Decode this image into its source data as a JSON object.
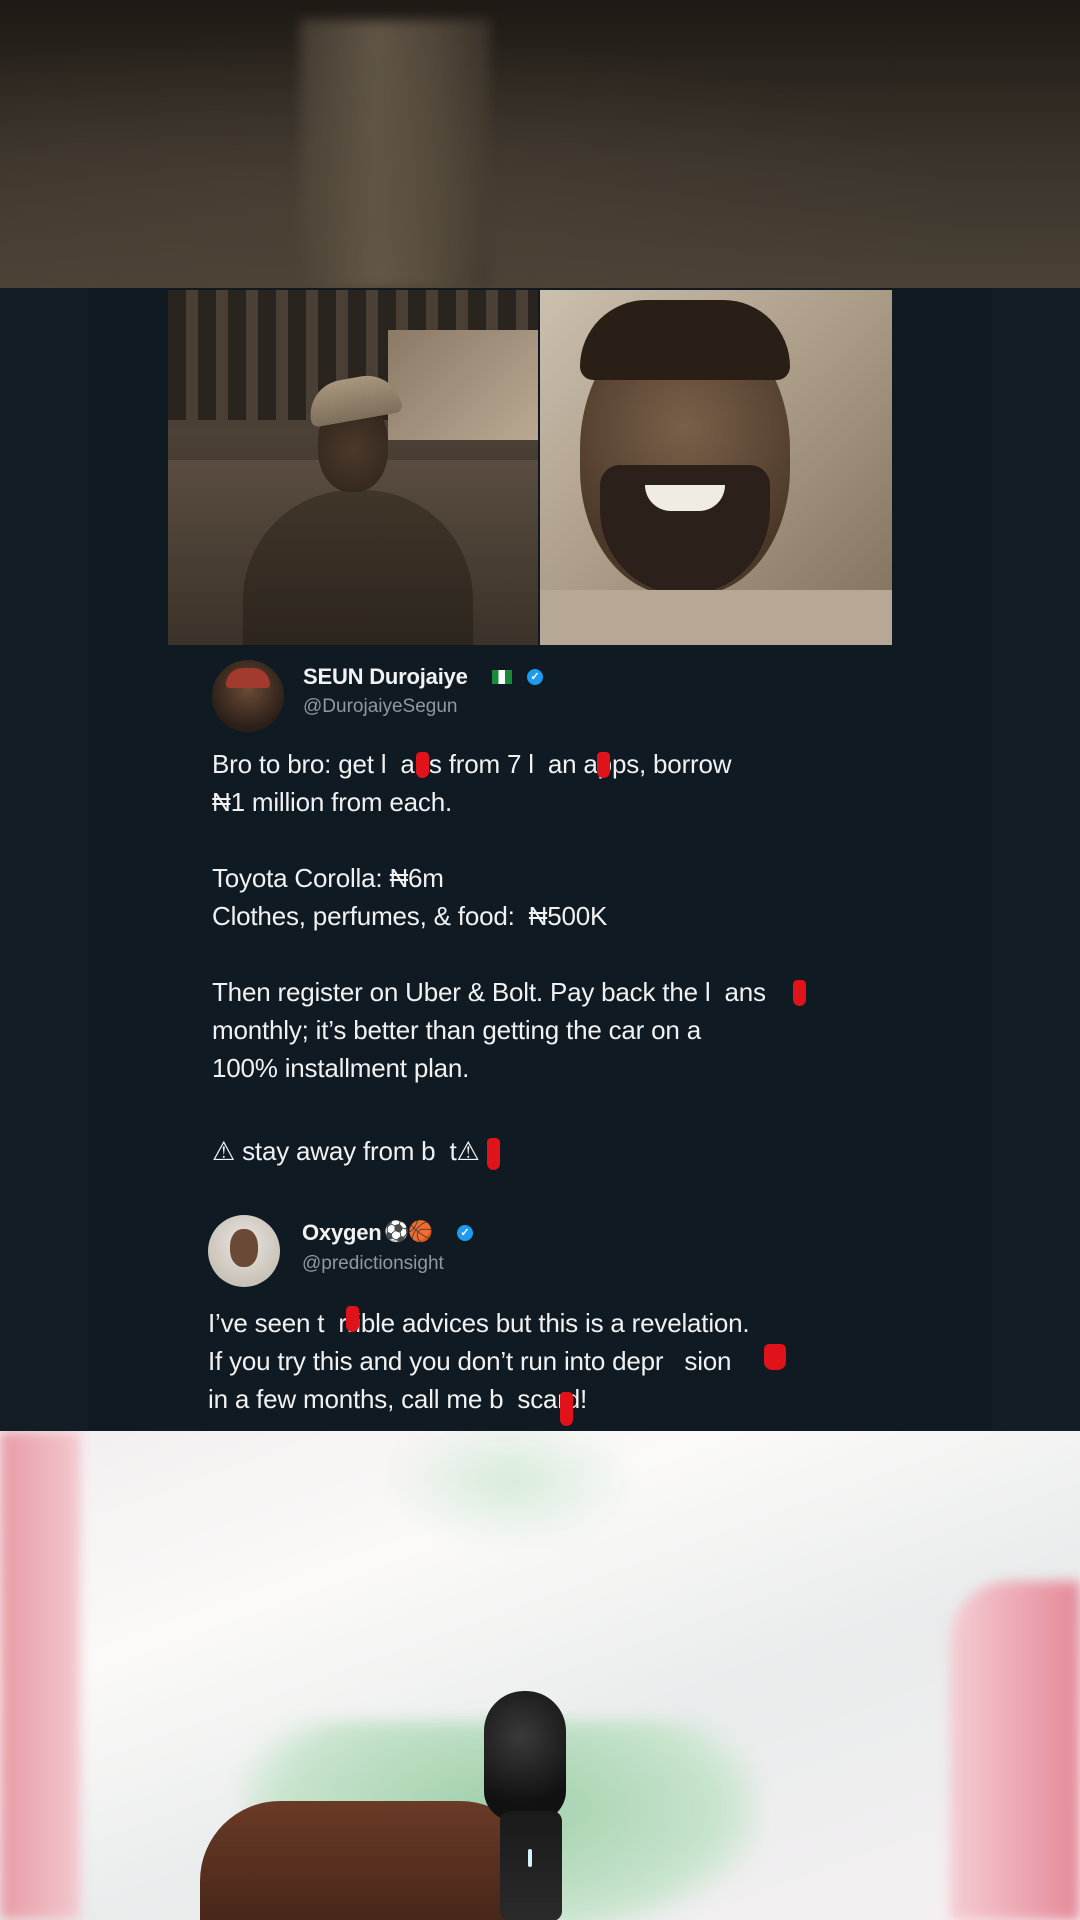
{
  "tweet1": {
    "name": "SEUN Durojaiye",
    "handle": "@DurojaiyeSegun",
    "lines": [
      "Bro to bro: get l  ans from 7 l  an apps, borrow",
      "₦1 million from each.",
      "",
      "Toyota Corolla: ₦6m",
      "Clothes, perfumes, & food:  ₦500K",
      "",
      "Then register on Uber & Bolt. Pay back the l  ans",
      "monthly; it’s better than getting the car on a",
      "100% installment plan.",
      "",
      "⚠ stay away from b  t⚠"
    ]
  },
  "tweet2": {
    "name": "Oxygen",
    "handle": "@predictionsight",
    "lines": [
      "I’ve seen t  rrible advices but this is a revelation.",
      "If you try this and you don’t run into depr   sion",
      "in a few months, call me b  scard!"
    ]
  },
  "colors": {
    "band_bg": "#0f1a22",
    "text": "#f1f1f1",
    "handle": "#8e98a2",
    "verified": "#1d9bf0",
    "redaction": "#e0121a"
  },
  "icons": {
    "verified": "verified-badge-icon",
    "flag": "nigeria-flag-icon",
    "warning": "warning-icon"
  }
}
